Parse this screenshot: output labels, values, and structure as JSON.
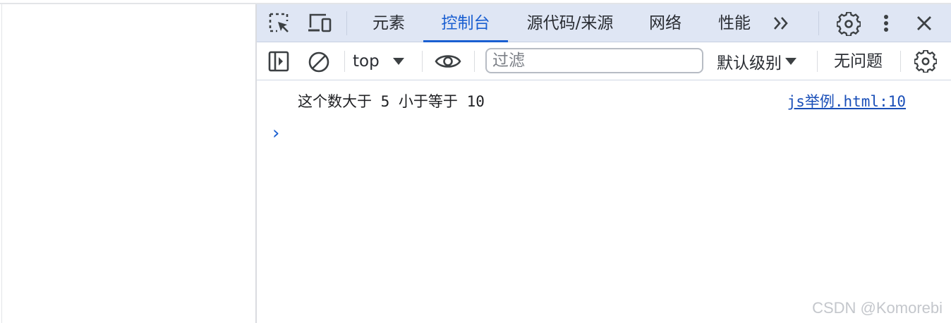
{
  "tabbar": {
    "tabs": [
      {
        "label": "元素"
      },
      {
        "label": "控制台"
      },
      {
        "label": "源代码/来源"
      },
      {
        "label": "网络"
      },
      {
        "label": "性能"
      }
    ],
    "more_tabs_label": "»",
    "icons": [
      "inspect-element-icon",
      "device-toolbar-icon",
      "more-tabs-icon",
      "settings-icon",
      "more-menu-icon",
      "close-icon"
    ]
  },
  "toolbar": {
    "context": "top",
    "filter_placeholder": "过滤",
    "filter_value": "",
    "level": "默认级别",
    "issues": "无问题",
    "icons": [
      "sidebar-toggle-icon",
      "clear-console-icon",
      "dropdown-arrow-icon",
      "live-expression-eye-icon",
      "console-settings-icon"
    ]
  },
  "console": {
    "messages": [
      {
        "text": "这个数大于 5 小于等于 10",
        "source": "js举例.html:10"
      }
    ],
    "prompt": "›"
  },
  "watermark": "CSDN @Komorebi",
  "colors": {
    "accent": "#1a5fd1",
    "tabbar_bg": "#dfe6f4",
    "link": "#1a4fb8"
  }
}
